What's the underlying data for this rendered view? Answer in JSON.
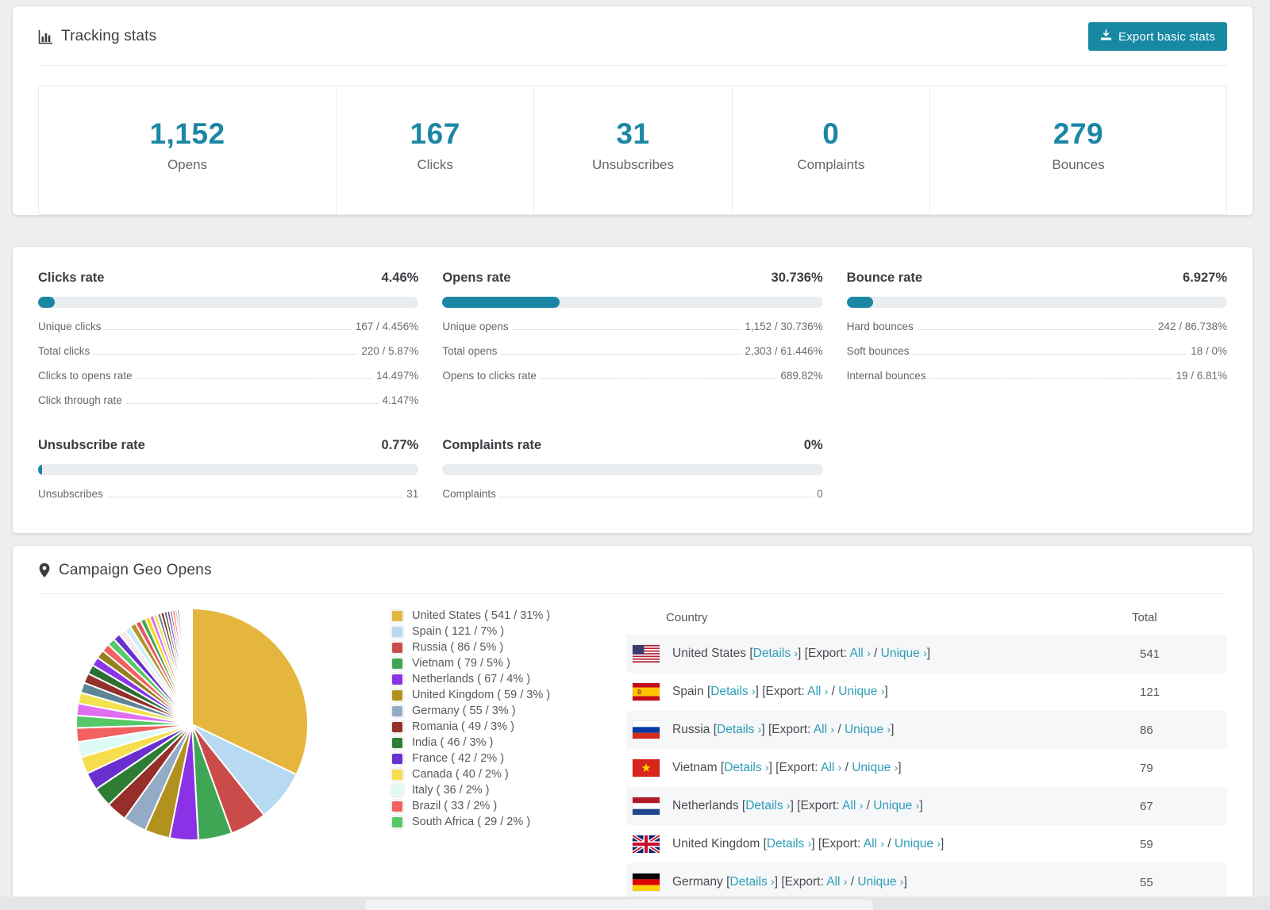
{
  "accent_color": "#1b87a5",
  "link_color": "#2d9db8",
  "tracking": {
    "title": "Tracking stats",
    "export_label": "Export basic stats",
    "stats": [
      {
        "value": "1,152",
        "label": "Opens"
      },
      {
        "value": "167",
        "label": "Clicks"
      },
      {
        "value": "31",
        "label": "Unsubscribes"
      },
      {
        "value": "0",
        "label": "Complaints"
      },
      {
        "value": "279",
        "label": "Bounces"
      }
    ]
  },
  "rates": [
    {
      "title": "Clicks rate",
      "value": "4.46%",
      "pct": 4.46,
      "rows": [
        [
          "Unique clicks",
          "167 / 4.456%"
        ],
        [
          "Total clicks",
          "220 / 5.87%"
        ],
        [
          "Clicks to opens rate",
          "14.497%"
        ],
        [
          "Click through rate",
          "4.147%"
        ]
      ]
    },
    {
      "title": "Opens rate",
      "value": "30.736%",
      "pct": 30.736,
      "rows": [
        [
          "Unique opens",
          "1,152 / 30.736%"
        ],
        [
          "Total opens",
          "2,303 / 61.446%"
        ],
        [
          "Opens to clicks rate",
          "689.82%"
        ]
      ]
    },
    {
      "title": "Bounce rate",
      "value": "6.927%",
      "pct": 6.927,
      "rows": [
        [
          "Hard bounces",
          "242 / 86.738%"
        ],
        [
          "Soft bounces",
          "18 / 0%"
        ],
        [
          "Internal bounces",
          "19 / 6.81%"
        ]
      ]
    },
    {
      "title": "Unsubscribe rate",
      "value": "0.77%",
      "pct": 0.77,
      "rows": [
        [
          "Unsubscribes",
          "31"
        ]
      ]
    },
    {
      "title": "Complaints rate",
      "value": "0%",
      "pct": 0,
      "rows": [
        [
          "Complaints",
          "0"
        ]
      ]
    }
  ],
  "geo": {
    "title": "Campaign Geo Opens",
    "table": {
      "columns": [
        "Country",
        "Total"
      ],
      "link_details": "Details",
      "export_prefix": "Export:",
      "link_all": "All",
      "link_unique": "Unique",
      "rows": [
        {
          "country": "United States",
          "flag": "us",
          "total": "541"
        },
        {
          "country": "Spain",
          "flag": "es",
          "total": "121"
        },
        {
          "country": "Russia",
          "flag": "ru",
          "total": "86"
        },
        {
          "country": "Vietnam",
          "flag": "vn",
          "total": "79"
        },
        {
          "country": "Netherlands",
          "flag": "nl",
          "total": "67"
        },
        {
          "country": "United Kingdom",
          "flag": "gb",
          "total": "59"
        },
        {
          "country": "Germany",
          "flag": "de",
          "total": "55"
        }
      ]
    }
  },
  "chart_data": {
    "type": "pie",
    "title": "Campaign Geo Opens",
    "legend_position": "right",
    "start_angle_deg": -90,
    "direction": "clockwise",
    "slices": [
      {
        "label": "United States",
        "value": 541,
        "pct": 31,
        "color": "#e4b63d"
      },
      {
        "label": "Spain",
        "value": 121,
        "pct": 7,
        "color": "#b7d9f1"
      },
      {
        "label": "Russia",
        "value": 86,
        "pct": 5,
        "color": "#cb4a4a"
      },
      {
        "label": "Vietnam",
        "value": 79,
        "pct": 5,
        "color": "#3ea654"
      },
      {
        "label": "Netherlands",
        "value": 67,
        "pct": 4,
        "color": "#8c32e6"
      },
      {
        "label": "United Kingdom",
        "value": 59,
        "pct": 3,
        "color": "#b2921f"
      },
      {
        "label": "Germany",
        "value": 55,
        "pct": 3,
        "color": "#93abc6"
      },
      {
        "label": "Romania",
        "value": 49,
        "pct": 3,
        "color": "#962f29"
      },
      {
        "label": "India",
        "value": 46,
        "pct": 3,
        "color": "#2e7d34"
      },
      {
        "label": "France",
        "value": 42,
        "pct": 2,
        "color": "#6930cf"
      },
      {
        "label": "Canada",
        "value": 40,
        "pct": 2,
        "color": "#f5dd4e"
      },
      {
        "label": "Italy",
        "value": 36,
        "pct": 2,
        "color": "#defaf4"
      },
      {
        "label": "Brazil",
        "value": 33,
        "pct": 2,
        "color": "#f26060"
      },
      {
        "label": "South Africa",
        "value": 29,
        "pct": 2,
        "color": "#55c967"
      }
    ],
    "legend_item_format": "{label} ( {value} / {pct}% )",
    "tail": {
      "note": "unlabeled long-tail countries drawn as thin slices",
      "values": [
        28,
        26,
        24,
        23,
        22,
        21,
        20,
        19,
        18,
        17,
        16,
        15,
        14,
        13,
        12,
        11,
        10,
        9,
        8,
        8,
        7,
        7,
        6,
        6,
        5,
        5,
        4,
        4,
        3,
        3,
        3,
        2,
        2,
        2,
        2,
        1,
        1,
        1,
        1,
        1
      ],
      "colors_cycle": [
        "#e06ff0",
        "#f2e24e",
        "#5e8596",
        "#93302a",
        "#2d6e35",
        "#8a35e8",
        "#96801f",
        "#f2605f",
        "#57c96a",
        "#6a2fd0",
        "#f8e9ef",
        "#cfeef8",
        "#b39524",
        "#e8536a",
        "#3fa854",
        "#ffd700"
      ]
    }
  }
}
